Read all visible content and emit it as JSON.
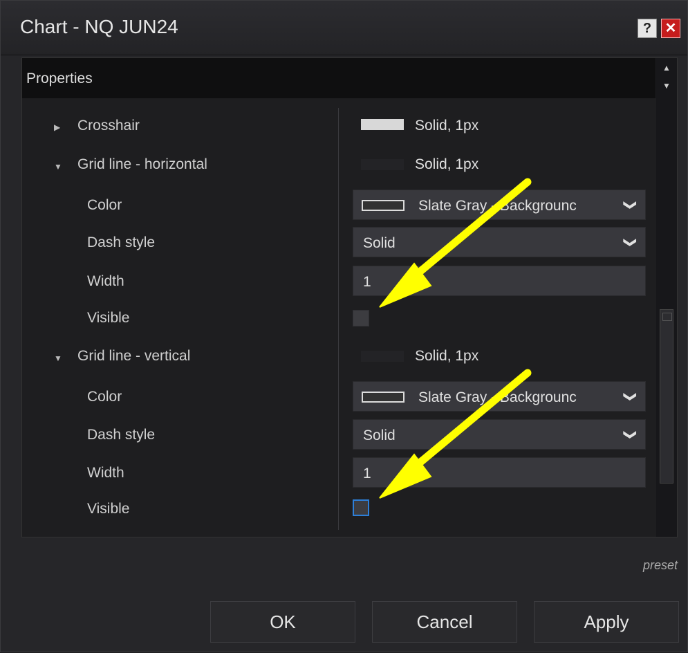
{
  "window": {
    "title": "Chart - NQ JUN24",
    "help_glyph": "?",
    "close_glyph": "✕"
  },
  "properties": {
    "header": "Properties",
    "rows": [
      {
        "label": "Crosshair",
        "value": "Solid, 1px"
      },
      {
        "label": "Grid line - horizontal",
        "value": "Solid, 1px"
      },
      {
        "label": "Color",
        "value": "Slate Gray - Backgrounc"
      },
      {
        "label": "Dash style",
        "value": "Solid"
      },
      {
        "label": "Width",
        "value": "1"
      },
      {
        "label": "Visible",
        "checked": false
      },
      {
        "label": "Grid line - vertical",
        "value": "Solid, 1px"
      },
      {
        "label": "Color",
        "value": "Slate Gray - Backgrounc"
      },
      {
        "label": "Dash style",
        "value": "Solid"
      },
      {
        "label": "Width",
        "value": "1"
      },
      {
        "label": "Visible",
        "checked": false
      }
    ]
  },
  "preset_label": "preset",
  "buttons": {
    "ok": "OK",
    "cancel": "Cancel",
    "apply": "Apply"
  },
  "icons": {
    "collapsed": "▶",
    "expanded": "▼",
    "chevron": "❯",
    "scroll_up": "▲",
    "scroll_down": "▼"
  },
  "colors": {
    "annotation_arrow": "#ffff00",
    "checkbox_focus": "#2d7fd8",
    "close_button": "#c61c1c"
  }
}
